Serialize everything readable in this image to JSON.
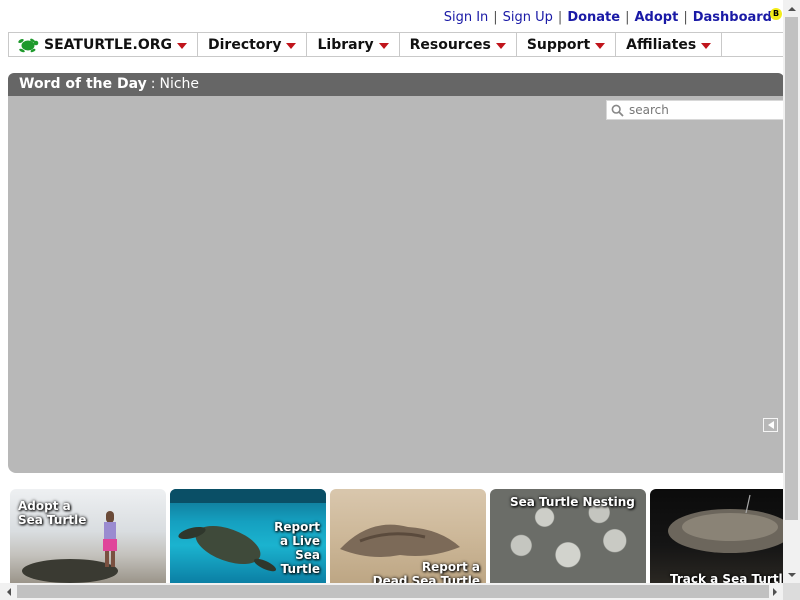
{
  "toplinks": {
    "sign_in": "Sign In",
    "sign_up": "Sign Up",
    "donate": "Donate",
    "adopt": "Adopt",
    "dashboard": "Dashboard",
    "dashboard_badge": "B",
    "separator": "|"
  },
  "nav": {
    "brand": "SEATURTLE.ORG",
    "items": [
      "Directory",
      "Library",
      "Resources",
      "Support",
      "Affiliates"
    ]
  },
  "word_of_day": {
    "label": "Word of the Day",
    "separator": ":",
    "word": "Niche"
  },
  "search": {
    "placeholder": "search"
  },
  "tiles": [
    {
      "caption": "Adopt a\nSea Turtle"
    },
    {
      "caption": "Report\na Live\nSea\nTurtle"
    },
    {
      "caption": "Report a\nDead Sea Turtle"
    },
    {
      "caption": "Sea Turtle Nesting"
    },
    {
      "caption": "Track a Sea Turtle"
    }
  ],
  "colors": {
    "link": "#1a1aa6",
    "nav_arrow": "#c0141b",
    "wotd_bar": "#666666",
    "hero_bg": "#b8b8b8",
    "badge": "#f3ec19"
  }
}
